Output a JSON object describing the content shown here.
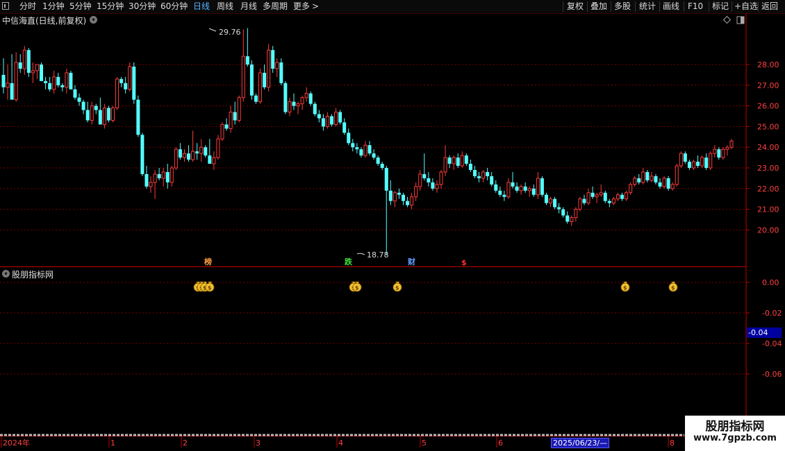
{
  "toolbar": {
    "left_items": [
      {
        "label": "分时",
        "active": false
      },
      {
        "label": "1分钟",
        "active": false
      },
      {
        "label": "5分钟",
        "active": false
      },
      {
        "label": "15分钟",
        "active": false
      },
      {
        "label": "30分钟",
        "active": false
      },
      {
        "label": "60分钟",
        "active": false
      },
      {
        "label": "日线",
        "active": true
      },
      {
        "label": "周线",
        "active": false
      },
      {
        "label": "月线",
        "active": false
      },
      {
        "label": "多周期",
        "active": false
      },
      {
        "label": "更多",
        "active": false
      }
    ],
    "more_arrow": ">",
    "right_items": [
      "复权",
      "叠加",
      "多股",
      "统计",
      "画线",
      "F10",
      "标记",
      "+自选",
      "返回"
    ]
  },
  "stock": {
    "title": "中信海直(日线,前复权)",
    "title_icon": "chevron-down-icon"
  },
  "indicator": {
    "title": "股朋指标网",
    "title_icon": "chevron-down-icon"
  },
  "colors": {
    "up": "#ff3c3c",
    "down": "#54ffff",
    "grid": "#7a0000",
    "axis": "#c00000",
    "label": "#ff4040"
  },
  "price_axis": {
    "ticks": [
      "28.00",
      "27.00",
      "26.00",
      "25.00",
      "24.00",
      "23.00",
      "22.00",
      "21.00",
      "20.00"
    ]
  },
  "indicator_axis": {
    "ticks": [
      "0.00",
      "-0.02",
      "-0.04",
      "-0.06"
    ],
    "current": "-0.04"
  },
  "annotations": {
    "high": "29.76",
    "low": "18.78"
  },
  "event_markers": [
    {
      "label": "榜",
      "color": "#ffa040"
    },
    {
      "label": "跌",
      "color": "#40e040"
    },
    {
      "label": "财",
      "color": "#60a0ff"
    },
    {
      "label": "$",
      "color": "#ff3030"
    }
  ],
  "signal_icon": "money-bag-icon",
  "time_axis": {
    "labels": [
      "2024年",
      "1",
      "2",
      "3",
      "4",
      "5",
      "6",
      "8"
    ],
    "current_date": "2025/06/23/—"
  },
  "watermark": {
    "line1": "股朋指标网",
    "line2": "www.7gpzb.com"
  },
  "chart_data": {
    "type": "candlestick",
    "ylim": [
      18.5,
      30.5
    ],
    "ohlc": [
      [
        27.5,
        28.3,
        26.6,
        26.9
      ],
      [
        26.9,
        28.0,
        26.3,
        27.1
      ],
      [
        27.1,
        28.5,
        26.5,
        26.3
      ],
      [
        26.3,
        28.6,
        26.2,
        28.1
      ],
      [
        28.1,
        28.5,
        27.6,
        27.8
      ],
      [
        27.8,
        28.9,
        27.5,
        28.7
      ],
      [
        28.7,
        28.8,
        27.4,
        27.6
      ],
      [
        27.6,
        28.1,
        27.1,
        27.7
      ],
      [
        27.7,
        28.0,
        27.3,
        28.0
      ],
      [
        28.0,
        28.1,
        27.2,
        27.2
      ],
      [
        27.2,
        27.4,
        26.8,
        27.1
      ],
      [
        27.1,
        27.4,
        26.7,
        26.8
      ],
      [
        26.8,
        27.7,
        26.6,
        27.4
      ],
      [
        27.4,
        27.6,
        26.9,
        27.0
      ],
      [
        27.0,
        27.1,
        26.7,
        26.9
      ],
      [
        26.9,
        27.8,
        26.6,
        27.6
      ],
      [
        27.6,
        27.7,
        26.8,
        26.8
      ],
      [
        26.8,
        27.0,
        26.3,
        26.4
      ],
      [
        26.4,
        26.6,
        26.0,
        26.2
      ],
      [
        26.2,
        26.3,
        25.6,
        25.8
      ],
      [
        25.8,
        26.2,
        25.2,
        25.3
      ],
      [
        25.3,
        26.2,
        25.1,
        26.0
      ],
      [
        26.0,
        26.1,
        25.6,
        25.8
      ],
      [
        25.8,
        26.4,
        25.4,
        25.1
      ],
      [
        25.1,
        26.1,
        24.9,
        25.9
      ],
      [
        25.9,
        26.0,
        25.2,
        25.3
      ],
      [
        25.3,
        26.0,
        25.2,
        25.9
      ],
      [
        25.9,
        27.4,
        25.8,
        27.3
      ],
      [
        27.3,
        27.4,
        26.9,
        27.1
      ],
      [
        27.1,
        27.4,
        26.6,
        26.8
      ],
      [
        26.8,
        28.1,
        26.7,
        27.9
      ],
      [
        27.9,
        28.1,
        26.1,
        26.3
      ],
      [
        26.3,
        26.5,
        24.5,
        24.6
      ],
      [
        24.6,
        24.7,
        22.6,
        22.7
      ],
      [
        22.7,
        23.1,
        22.0,
        22.1
      ],
      [
        22.1,
        22.6,
        21.8,
        22.3
      ],
      [
        22.3,
        22.9,
        21.5,
        22.7
      ],
      [
        22.7,
        23.0,
        22.4,
        22.5
      ],
      [
        22.5,
        23.0,
        22.1,
        22.8
      ],
      [
        22.8,
        23.2,
        22.0,
        22.3
      ],
      [
        22.3,
        23.1,
        22.1,
        23.0
      ],
      [
        23.0,
        24.0,
        22.9,
        23.9
      ],
      [
        23.9,
        24.2,
        23.4,
        23.5
      ],
      [
        23.5,
        23.9,
        23.3,
        23.7
      ],
      [
        23.7,
        24.1,
        23.3,
        23.4
      ],
      [
        23.4,
        24.8,
        23.3,
        23.8
      ],
      [
        23.8,
        24.2,
        23.4,
        23.7
      ],
      [
        23.7,
        24.4,
        23.3,
        24.0
      ],
      [
        24.0,
        24.1,
        23.5,
        23.6
      ],
      [
        23.6,
        24.4,
        23.4,
        23.2
      ],
      [
        23.2,
        23.8,
        22.9,
        23.5
      ],
      [
        23.5,
        24.6,
        23.4,
        24.4
      ],
      [
        24.4,
        25.2,
        24.3,
        25.1
      ],
      [
        25.1,
        25.4,
        24.8,
        24.9
      ],
      [
        24.9,
        26.0,
        24.7,
        25.7
      ],
      [
        25.7,
        26.2,
        25.1,
        25.3
      ],
      [
        25.3,
        26.5,
        25.2,
        26.4
      ],
      [
        26.4,
        29.7,
        26.2,
        28.4
      ],
      [
        28.4,
        29.76,
        27.9,
        28.0
      ],
      [
        28.0,
        28.2,
        26.3,
        26.5
      ],
      [
        26.5,
        26.6,
        26.1,
        26.2
      ],
      [
        26.2,
        27.8,
        26.1,
        27.6
      ],
      [
        27.6,
        28.0,
        26.8,
        26.9
      ],
      [
        26.9,
        29.0,
        26.7,
        28.7
      ],
      [
        28.7,
        28.9,
        27.6,
        27.8
      ],
      [
        27.8,
        28.3,
        27.4,
        28.1
      ],
      [
        28.1,
        28.3,
        27.0,
        27.1
      ],
      [
        27.1,
        27.2,
        25.6,
        25.7
      ],
      [
        25.7,
        26.4,
        25.5,
        26.2
      ],
      [
        26.2,
        26.6,
        25.8,
        26.0
      ],
      [
        26.0,
        26.2,
        25.6,
        26.1
      ],
      [
        26.1,
        26.5,
        25.8,
        26.4
      ],
      [
        26.4,
        26.9,
        26.2,
        26.6
      ],
      [
        26.6,
        26.7,
        26.0,
        26.1
      ],
      [
        26.1,
        26.2,
        25.5,
        25.6
      ],
      [
        25.6,
        25.8,
        25.2,
        25.4
      ],
      [
        25.4,
        25.6,
        24.8,
        25.0
      ],
      [
        25.0,
        25.7,
        24.9,
        25.5
      ],
      [
        25.5,
        25.6,
        25.0,
        25.1
      ],
      [
        25.1,
        25.9,
        25.0,
        25.7
      ],
      [
        25.7,
        25.8,
        25.1,
        25.2
      ],
      [
        25.2,
        25.4,
        24.6,
        24.7
      ],
      [
        24.7,
        24.9,
        24.1,
        24.2
      ],
      [
        24.2,
        24.4,
        23.8,
        24.0
      ],
      [
        24.0,
        24.2,
        23.7,
        23.9
      ],
      [
        23.9,
        24.0,
        23.5,
        23.6
      ],
      [
        23.6,
        24.3,
        23.5,
        24.1
      ],
      [
        24.1,
        24.3,
        23.6,
        23.7
      ],
      [
        23.7,
        23.9,
        23.4,
        23.5
      ],
      [
        23.5,
        23.6,
        23.1,
        23.2
      ],
      [
        23.2,
        23.3,
        22.9,
        23.0
      ],
      [
        23.0,
        23.1,
        18.78,
        21.9
      ],
      [
        21.9,
        22.4,
        21.2,
        21.4
      ],
      [
        21.4,
        21.9,
        21.1,
        21.8
      ],
      [
        21.8,
        22.0,
        21.5,
        21.7
      ],
      [
        21.7,
        21.8,
        21.2,
        21.4
      ],
      [
        21.4,
        21.6,
        21.1,
        21.2
      ],
      [
        21.2,
        21.8,
        21.0,
        21.6
      ],
      [
        21.6,
        22.3,
        21.4,
        22.1
      ],
      [
        22.1,
        22.9,
        21.9,
        22.7
      ],
      [
        22.7,
        23.7,
        22.4,
        22.5
      ],
      [
        22.5,
        22.8,
        22.1,
        22.3
      ],
      [
        22.3,
        22.5,
        21.9,
        22.0
      ],
      [
        22.0,
        22.4,
        21.8,
        22.2
      ],
      [
        22.2,
        22.9,
        22.0,
        22.8
      ],
      [
        22.8,
        24.1,
        22.6,
        23.5
      ],
      [
        23.5,
        23.6,
        23.0,
        23.2
      ],
      [
        23.2,
        23.6,
        22.9,
        23.5
      ],
      [
        23.5,
        23.7,
        23.0,
        23.1
      ],
      [
        23.1,
        23.8,
        23.0,
        23.6
      ],
      [
        23.6,
        23.7,
        23.1,
        23.2
      ],
      [
        23.2,
        23.4,
        22.8,
        22.9
      ],
      [
        22.9,
        23.1,
        22.5,
        22.6
      ],
      [
        22.6,
        22.8,
        22.3,
        22.5
      ],
      [
        22.5,
        22.9,
        22.3,
        22.8
      ],
      [
        22.8,
        23.0,
        22.4,
        22.6
      ],
      [
        22.6,
        22.8,
        22.1,
        22.2
      ],
      [
        22.2,
        22.4,
        21.8,
        21.9
      ],
      [
        21.9,
        22.1,
        21.6,
        21.7
      ],
      [
        21.7,
        21.9,
        21.4,
        21.6
      ],
      [
        21.6,
        22.5,
        21.5,
        22.3
      ],
      [
        22.3,
        22.8,
        22.0,
        22.1
      ],
      [
        22.1,
        22.3,
        21.8,
        21.9
      ],
      [
        21.9,
        22.2,
        21.7,
        22.1
      ],
      [
        22.1,
        22.3,
        21.8,
        21.9
      ],
      [
        21.9,
        22.1,
        21.6,
        22.0
      ],
      [
        22.0,
        22.2,
        21.6,
        21.7
      ],
      [
        21.7,
        22.8,
        21.5,
        22.5
      ],
      [
        22.5,
        22.6,
        21.6,
        21.7
      ],
      [
        21.7,
        21.8,
        21.2,
        21.3
      ],
      [
        21.3,
        21.6,
        21.1,
        21.5
      ],
      [
        21.5,
        21.6,
        21.0,
        21.1
      ],
      [
        21.1,
        21.3,
        20.8,
        21.0
      ],
      [
        21.0,
        21.1,
        20.6,
        20.7
      ],
      [
        20.7,
        20.9,
        20.3,
        20.4
      ],
      [
        20.4,
        20.7,
        20.2,
        20.6
      ],
      [
        20.6,
        21.1,
        20.4,
        21.0
      ],
      [
        21.0,
        21.6,
        20.9,
        21.5
      ],
      [
        21.5,
        21.7,
        21.2,
        21.3
      ],
      [
        21.3,
        22.0,
        21.2,
        21.8
      ],
      [
        21.8,
        22.1,
        21.5,
        21.6
      ],
      [
        21.6,
        21.8,
        21.3,
        21.7
      ],
      [
        21.7,
        22.2,
        21.6,
        21.8
      ],
      [
        21.8,
        21.9,
        21.3,
        21.4
      ],
      [
        21.4,
        21.5,
        21.1,
        21.3
      ],
      [
        21.3,
        21.6,
        21.2,
        21.5
      ],
      [
        21.5,
        21.8,
        21.4,
        21.7
      ],
      [
        21.7,
        21.8,
        21.4,
        21.5
      ],
      [
        21.5,
        21.9,
        21.4,
        21.8
      ],
      [
        21.8,
        22.3,
        21.7,
        22.2
      ],
      [
        22.2,
        22.6,
        22.1,
        22.5
      ],
      [
        22.5,
        22.7,
        22.2,
        22.3
      ],
      [
        22.3,
        23.0,
        22.2,
        22.8
      ],
      [
        22.8,
        22.9,
        22.3,
        22.4
      ],
      [
        22.4,
        22.8,
        22.3,
        22.6
      ],
      [
        22.6,
        22.7,
        22.2,
        22.3
      ],
      [
        22.3,
        22.5,
        22.0,
        22.1
      ],
      [
        22.1,
        22.6,
        22.0,
        22.5
      ],
      [
        22.5,
        22.6,
        21.9,
        22.0
      ],
      [
        22.0,
        22.3,
        21.9,
        22.2
      ],
      [
        22.2,
        23.2,
        22.1,
        23.1
      ],
      [
        23.1,
        23.8,
        23.0,
        23.7
      ],
      [
        23.7,
        23.8,
        23.2,
        23.3
      ],
      [
        23.3,
        23.4,
        22.9,
        23.0
      ],
      [
        23.0,
        23.4,
        22.9,
        23.3
      ],
      [
        23.3,
        23.6,
        23.0,
        23.1
      ],
      [
        23.1,
        23.6,
        23.0,
        23.5
      ],
      [
        23.5,
        23.7,
        22.9,
        23.0
      ],
      [
        23.0,
        23.8,
        22.9,
        23.7
      ],
      [
        23.7,
        24.1,
        23.5,
        23.9
      ],
      [
        23.9,
        24.0,
        23.4,
        23.5
      ],
      [
        23.5,
        24.0,
        23.4,
        23.9
      ],
      [
        23.9,
        24.1,
        23.6,
        24.0
      ],
      [
        24.0,
        24.4,
        23.9,
        24.3
      ]
    ]
  }
}
